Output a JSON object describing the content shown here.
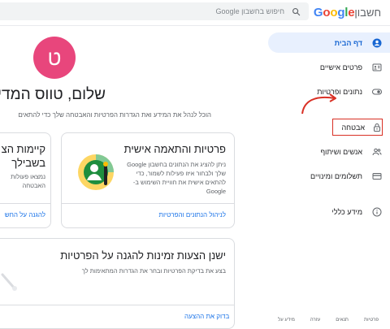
{
  "header": {
    "logo_text": "Google",
    "logo_suffix": "חשבון",
    "search_placeholder": "חיפוש בחשבון Google"
  },
  "sidebar": {
    "items": [
      {
        "label": "דף הבית",
        "icon": "account-circle-icon"
      },
      {
        "label": "פרטים אישיים",
        "icon": "id-card-icon"
      },
      {
        "label": "נתונים ופרטיות",
        "icon": "toggle-icon"
      },
      {
        "label": "אבטחה",
        "icon": "lock-icon"
      },
      {
        "label": "אנשים ושיתוף",
        "icon": "people-icon"
      },
      {
        "label": "תשלומים ומינויים",
        "icon": "credit-card-icon"
      },
      {
        "label": "מידע כללי",
        "icon": "info-icon"
      }
    ]
  },
  "main": {
    "avatar_letter": "ט",
    "avatar_color": "#e8467c",
    "greeting": "שלום, טווס המדיה",
    "subtitle": "הוכל לנהל את המידע ואת הגדרות הפרטיות והאבטחה שלך כדי להתאים",
    "privacy_card": {
      "title": "פרטיות והתאמה אישית",
      "body": "ניתן להציג את הנתונים בחשבון Google שלך ולבחור איזו פעילות לשמור, כדי להתאים אישית את חוויית השימוש ב-Google",
      "link": "לניהול הנתונים והפרטיות"
    },
    "security_card": {
      "title_line1": "קיימות הצ",
      "title_line2": "בשבילך",
      "body": "נמצאו פעולות האבטחה",
      "link": "להגנה על החש"
    },
    "suggestion_card": {
      "title": "ישנן הצעות זמינות להגנה על הפרטיות",
      "body": "בצע את בדיקת הפרטיות ובחר את הגדרות המתאימות לך",
      "link": "בדוק את ההצעה"
    }
  },
  "footer": {
    "links": [
      "פרטיות",
      "תנאים",
      "עזרה",
      "מידע על"
    ]
  },
  "colors": {
    "accent": "#1a73e8",
    "active_bg": "#e8f0fe",
    "highlight": "#d93025"
  }
}
